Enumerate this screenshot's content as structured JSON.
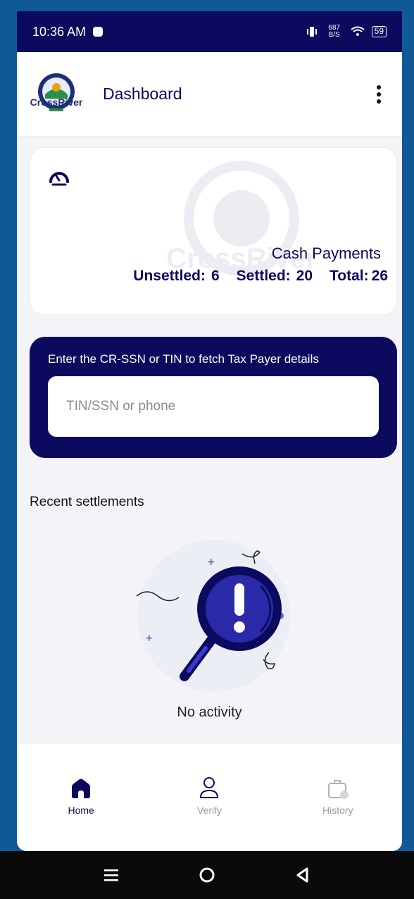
{
  "status_bar": {
    "time": "10:36 AM",
    "net_speed": "687 B/S",
    "battery": "59"
  },
  "header": {
    "logo_text": "CrossRiver",
    "title": "Dashboard"
  },
  "summary_card": {
    "watermark_text": "CrossRiver",
    "heading": "Cash Payments",
    "unsettled_label": "Unsettled:",
    "unsettled_value": "6",
    "settled_label": "Settled:",
    "settled_value": "20",
    "total_label": "Total:",
    "total_value": "26"
  },
  "search": {
    "prompt": "Enter the CR-SSN or TIN to fetch Tax Payer details",
    "placeholder": "TIN/SSN or phone",
    "value": ""
  },
  "recent": {
    "title": "Recent settlements",
    "empty_text": "No activity"
  },
  "bottom_nav": {
    "items": [
      {
        "label": "Home",
        "icon": "home-icon",
        "active": true
      },
      {
        "label": "Verify",
        "icon": "user-icon",
        "active": false
      },
      {
        "label": "History",
        "icon": "briefcase-clock-icon",
        "active": false
      }
    ]
  },
  "colors": {
    "primary": "#0c0a5e",
    "accent": "#2a2aa8",
    "frame": "#0f5a96"
  }
}
